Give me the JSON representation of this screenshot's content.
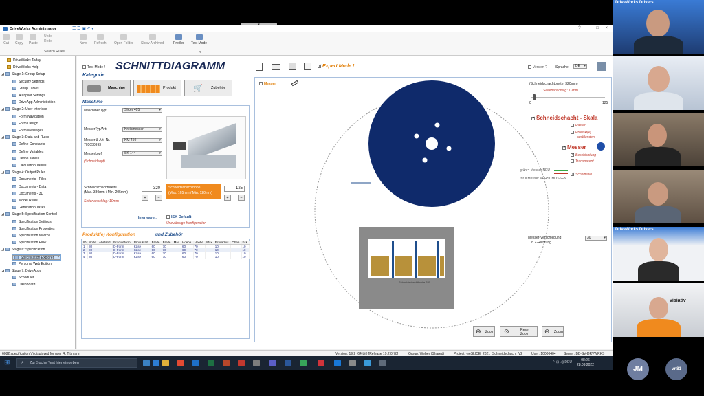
{
  "meeting": {
    "dock_tick": "▾",
    "tile_brand_1": "DriveWorks Drivers",
    "tile_brand_5": "DriveWorks Drivers",
    "tile_logo_6": "visiativ",
    "avatar_1": "JM",
    "avatar_2": "vn81"
  },
  "window": {
    "title": "DriveWorks Administrator",
    "qat": "☰ ☰ ▣ ↶ ▾",
    "buttons": "? – □ ×"
  },
  "ribbon": {
    "cut": "Cut",
    "copy": "Copy",
    "paste": "Paste",
    "undo": "Undo",
    "redo": "Redo",
    "new": "New",
    "refresh": "Refresh",
    "open_folder": "Open Folder",
    "show_archived": "Show Archived",
    "profiler": "Profiler",
    "test_mode": "Test Mode",
    "search_rules": "Search Rules",
    "caret": "▾"
  },
  "tree": [
    {
      "label": "DriveWorks Today",
      "level": 1,
      "kind": "home"
    },
    {
      "label": "DriveWorks Help",
      "level": 1,
      "kind": "home"
    },
    {
      "label": "Stage 1: Group Setup",
      "level": 0,
      "kind": "stage"
    },
    {
      "label": "Security Settings",
      "level": 2
    },
    {
      "label": "Group Tables",
      "level": 2
    },
    {
      "label": "Autopilot Settings",
      "level": 2
    },
    {
      "label": "DriveApp Administration",
      "level": 2
    },
    {
      "label": "Stage 2: User Interface",
      "level": 0,
      "kind": "stage"
    },
    {
      "label": "Form Navigation",
      "level": 2
    },
    {
      "label": "Form Design",
      "level": 2
    },
    {
      "label": "Form Messages",
      "level": 2
    },
    {
      "label": "Stage 3: Data and Rules",
      "level": 0,
      "kind": "stage"
    },
    {
      "label": "Define Constants",
      "level": 2
    },
    {
      "label": "Define Variables",
      "level": 2
    },
    {
      "label": "Define Tables",
      "level": 2
    },
    {
      "label": "Calculation Tables",
      "level": 2
    },
    {
      "label": "Stage 4: Output Rules",
      "level": 0,
      "kind": "stage"
    },
    {
      "label": "Documents - Files",
      "level": 2
    },
    {
      "label": "Documents - Data",
      "level": 2
    },
    {
      "label": "Documents - 3D",
      "level": 2
    },
    {
      "label": "Model Rules",
      "level": 2
    },
    {
      "label": "Generation Tasks",
      "level": 2
    },
    {
      "label": "Stage 5: Specification Control",
      "level": 0,
      "kind": "stage"
    },
    {
      "label": "Specification Settings",
      "level": 2
    },
    {
      "label": "Specification Properties",
      "level": 2
    },
    {
      "label": "Specification Macros",
      "level": 2
    },
    {
      "label": "Specification Flow",
      "level": 2
    },
    {
      "label": "Stage 6: Specification",
      "level": 0,
      "kind": "stage"
    },
    {
      "label": "Specification Explorer",
      "level": 2,
      "selected": true
    },
    {
      "label": "Personal Web Edition",
      "level": 2
    },
    {
      "label": "Stage 7: DriveApps",
      "level": 0,
      "kind": "stage"
    },
    {
      "label": "Scheduler",
      "level": 2
    },
    {
      "label": "Dashboard",
      "level": 2
    }
  ],
  "form": {
    "test_mode": "Test Mode !",
    "title": "SCHNITTDIAGRAMM",
    "expert_mode": "Expert Mode !",
    "version": "Version ?",
    "sprache_label": "Sprache",
    "sprache_value": "DE",
    "kategorie": "Kategorie",
    "cat_maschine": "Maschine",
    "cat_produkt": "Produkt",
    "cat_zubehoer": "Zubehör",
    "maschine_section": "Maschine",
    "maschinentyp_label": "MaschinenTyp:",
    "maschinentyp_value": "Slicer 405",
    "messertyp_label": "MesserTyp/Art:",
    "messertyp_value": "Kreismesser",
    "messer_nr_label": "Messer & Art.-Nr.",
    "messer_nr_sub": "705050993",
    "messer_nr_value": "KM 450",
    "messerkopf_label": "Messerkopf:",
    "messerkopf_value": "SK 144",
    "schneidkopf": "(Schneidkopf)",
    "sb_label1": "Schneidschachtbreite",
    "sb_label2": "(Max. 330mm / Min. 205mm)",
    "sb_value": "320",
    "seitenanschlag": "Seitenanschlag: 10mm",
    "sh_label1": "Schneidschachthöhe",
    "sh_label2": "(Max. 165mm / Min. 120mm)",
    "sh_value": "125",
    "plus": "+",
    "minus": "−",
    "interleaver_label": "Interleaver:",
    "isk_default": "ISK Default",
    "unzulaessig": "Unzulässige Konfiguration",
    "produkt_section": "Produkt(e) Konfiguration",
    "und_zubehoer": "und Zubehör",
    "table_headers": [
      "ID",
      "Node",
      "Abstand",
      "Produktform",
      "Produktart",
      "Breite",
      "Breite",
      "Max",
      "Hoehe",
      "Hoehe",
      "Max",
      "Eckradius",
      "Oben",
      "Eck"
    ],
    "table_rows": [
      [
        "1",
        "80",
        "",
        "D-Form",
        "Käse",
        "60",
        "70",
        "",
        "60",
        "70",
        "",
        "10",
        "",
        "10"
      ],
      [
        "2",
        "80",
        "",
        "D-Form",
        "Käse",
        "60",
        "70",
        "",
        "60",
        "70",
        "",
        "10",
        "",
        "10"
      ],
      [
        "3",
        "80",
        "",
        "D-Form",
        "Käse",
        "60",
        "70",
        "",
        "60",
        "70",
        "",
        "10",
        "",
        "10"
      ],
      [
        "4",
        "80",
        "",
        "D-Form",
        "Käse",
        "60",
        "70",
        "",
        "60",
        "70",
        "",
        "10",
        "",
        "10"
      ]
    ]
  },
  "diagram": {
    "messen": "Messen",
    "schneidschachtbreite_info": "(Schneidschachtbreite: 320mm)",
    "seitenanschlag_info": "Seitenanschlag: 10mm",
    "slider_min": "0",
    "slider_max": "125",
    "slider_fraction": 0.05,
    "skala_title": "Schneidschacht - Skala",
    "raster": "Raster",
    "produkte_ausblenden_1": "Produkt(e)",
    "produkte_ausblenden_2": "ausblenden",
    "messer_title": "Messer",
    "beschichtung": "Beschichtung",
    "transparent": "Transparent",
    "legend_new": "grün = Messer NEU",
    "legend_worn": "rot = Messer VERSCHLISSEN",
    "schnittlinie": "Schnittlinie",
    "verschiebung_1": "Messer-Verschiebung",
    "verschiebung_2": "...in Z-Richtung",
    "verschiebung_value": "30",
    "zoom_in": "Zoom",
    "reset_zoom_1": "Reset",
    "reset_zoom_2": "Zoom",
    "zoom_out": "Zoom",
    "inset_caption": "Schneidschachtbreite 320"
  },
  "status": {
    "left": "6082 specification(s) displayed for user R. Tittmann",
    "version": "Version: 19.2 (64-bit) [Release 19.2.0.78]",
    "group": "Group: Weber (Shared)",
    "project": "Project: weSLICE_2021_Schneidschacht_V2",
    "user": "User: 10000404",
    "server": "Server: BB-SV-DRVWRKS"
  },
  "taskbar": {
    "search_placeholder": "Zur Suche Text hier eingeben",
    "time": "08:26",
    "date": "28.09.2022",
    "tray": "⌃  ⊟  ◁)  DEU",
    "start_glyph": "⊞",
    "search_glyph": "⌕"
  },
  "colors": {
    "accent": "#1f4e8c",
    "orange": "#f08a1e",
    "blade": "#0f2a6b",
    "taskbar": "#1a2533"
  }
}
